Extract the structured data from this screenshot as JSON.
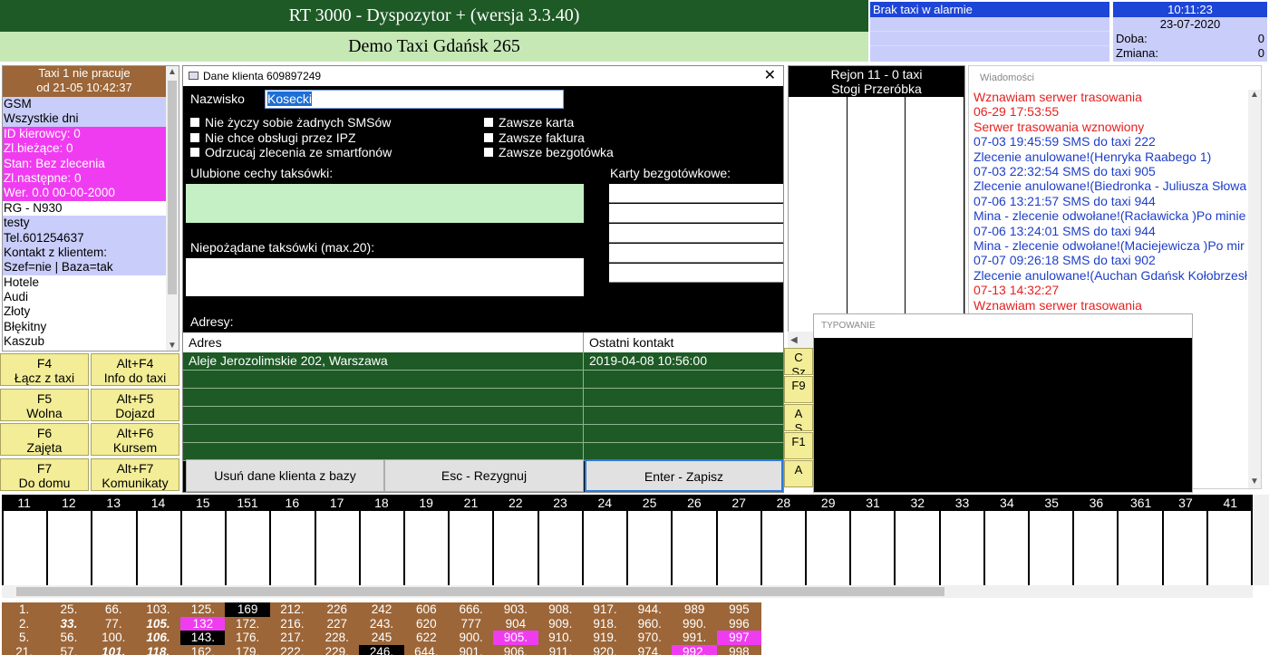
{
  "header": {
    "app_title": "RT 3000 - Dyspozytor + (wersja 3.3.40)",
    "company": "Demo Taxi Gdańsk 265"
  },
  "alarm": {
    "title": "Brak taxi w alarmie"
  },
  "clock": {
    "time": "10:11:23",
    "date": "23-07-2020",
    "doba_label": "Doba:",
    "doba_value": "0",
    "zmiana_label": "Zmiana:",
    "zmiana_value": "0"
  },
  "taxi_panel": {
    "header_line1": "Taxi 1 nie pracuje",
    "header_line2": "od 21-05  10:42:37",
    "lines": [
      {
        "text": "GSM",
        "style": "lav"
      },
      {
        "text": "Wszystkie dni",
        "style": "lav"
      },
      {
        "text": "ID kierowcy: 0",
        "style": "pink"
      },
      {
        "text": "Zl.bieżące: 0",
        "style": "pink"
      },
      {
        "text": "Stan: Bez zlecenia",
        "style": "pink"
      },
      {
        "text": "Zl.następne: 0",
        "style": "pink"
      },
      {
        "text": "Wer. 0.0 00-00-2000",
        "style": "pink"
      },
      {
        "text": "RG - N930",
        "style": "wht"
      },
      {
        "text": "testy",
        "style": "lav"
      },
      {
        "text": "Tel.601254637",
        "style": "lav"
      },
      {
        "text": "Kontakt z klientem:",
        "style": "lav"
      },
      {
        "text": "Szef=nie | Baza=tak",
        "style": "lav"
      },
      {
        "text": "Hotele",
        "style": "wht"
      },
      {
        "text": "Audi",
        "style": "wht"
      },
      {
        "text": "Złoty",
        "style": "wht"
      },
      {
        "text": "Błękitny",
        "style": "wht"
      },
      {
        "text": "Kaszub",
        "style": "wht"
      }
    ]
  },
  "fkeys": [
    {
      "key": "F4",
      "label": "Łącz z taxi"
    },
    {
      "key": "Alt+F4",
      "label": "Info do taxi"
    },
    {
      "key": "F5",
      "label": "Wolna"
    },
    {
      "key": "Alt+F5",
      "label": "Dojazd"
    },
    {
      "key": "F6",
      "label": "Zajęta"
    },
    {
      "key": "Alt+F6",
      "label": "Kursem"
    },
    {
      "key": "F7",
      "label": "Do domu"
    },
    {
      "key": "Alt+F7",
      "label": "Komunikaty"
    }
  ],
  "dialog": {
    "title": "Dane klienta 609897249",
    "close": "✕",
    "name_label": "Nazwisko",
    "name_value": "Kosecki",
    "checkboxes_left": [
      "Nie życzy sobie żadnych SMSów",
      "Nie chce obsługi przez IPZ",
      "Odrzucaj zlecenia ze smartfonów"
    ],
    "checkboxes_right": [
      "Zawsze karta",
      "Zawsze faktura",
      "Zawsze bezgotówka"
    ],
    "fav_label": "Ulubione cechy taksówki:",
    "cards_label": "Karty bezgotówkowe:",
    "unwanted_label": "Niepożądane taksówki (max.20):",
    "addresses_label": "Adresy:",
    "col_address": "Adres",
    "col_last_contact": "Ostatni kontakt",
    "addresses": [
      {
        "address": "Aleje Jerozolimskie 202, Warszawa",
        "last": "2019-04-08 10:56:00"
      },
      {
        "address": "",
        "last": ""
      },
      {
        "address": "",
        "last": ""
      },
      {
        "address": "",
        "last": ""
      },
      {
        "address": "",
        "last": ""
      },
      {
        "address": "",
        "last": ""
      }
    ],
    "btn_delete": "Usuń dane klienta z bazy",
    "btn_cancel": "Esc - Rezygnuj",
    "btn_save": "Enter - Zapisz"
  },
  "region": {
    "line1": "Rejon 11 - 0 taxi",
    "line2": "Stogi Przeróbka"
  },
  "messages": {
    "title": "Wiadomości",
    "items": [
      {
        "text": "Wznawiam serwer trasowania",
        "color": "red"
      },
      {
        "text": "06-29 17:53:55",
        "color": "red"
      },
      {
        "text": "Serwer trasowania wznowiony",
        "color": "red"
      },
      {
        "text": "07-03 19:45:59 SMS do taxi 222",
        "color": "blue"
      },
      {
        "text": "Zlecenie anulowane!(Henryka Raabego 1)",
        "color": "blue"
      },
      {
        "text": "07-03 22:32:54 SMS do taxi 905",
        "color": "blue"
      },
      {
        "text": "Zlecenie anulowane!(Biedronka - Juliusza Słowa",
        "color": "blue"
      },
      {
        "text": "07-06 13:21:57 SMS do taxi 944",
        "color": "blue"
      },
      {
        "text": "Mina - zlecenie odwołane!(Racławicka )Po minie",
        "color": "blue"
      },
      {
        "text": "07-06 13:24:01 SMS do taxi 944",
        "color": "blue"
      },
      {
        "text": "Mina - zlecenie odwołane!(Maciejewicza )Po mir",
        "color": "blue"
      },
      {
        "text": "07-07 09:26:18 SMS do taxi 902",
        "color": "blue"
      },
      {
        "text": "Zlecenie anulowane!(Auchan Gdańsk Kołobrzesł",
        "color": "blue"
      },
      {
        "text": "07-13 14:32:27",
        "color": "red"
      },
      {
        "text": "Wznawiam serwer trasowania",
        "color": "red"
      }
    ]
  },
  "typowanie": {
    "title": "TYPOWANIE"
  },
  "right_fkeys": [
    {
      "label": "C\nSz"
    },
    {
      "label": "F9"
    },
    {
      "label": "A\nS"
    },
    {
      "label": "F1"
    },
    {
      "label": "A"
    }
  ],
  "region_strip": [
    "11",
    "12",
    "13",
    "14",
    "15",
    "151",
    "16",
    "17",
    "18",
    "19",
    "21",
    "22",
    "23",
    "24",
    "25",
    "26",
    "27",
    "28",
    "29",
    "31",
    "32",
    "33",
    "34",
    "35",
    "36",
    "361",
    "37",
    "41"
  ],
  "bottom_rows": [
    [
      {
        "t": "1."
      },
      {
        "t": "25."
      },
      {
        "t": "66."
      },
      {
        "t": "103."
      },
      {
        "t": "125."
      },
      {
        "t": "169",
        "s": "bk"
      },
      {
        "t": "212."
      },
      {
        "t": "226"
      },
      {
        "t": "242"
      },
      {
        "t": "606"
      },
      {
        "t": "666."
      },
      {
        "t": "903."
      },
      {
        "t": "908."
      },
      {
        "t": "917."
      },
      {
        "t": "944."
      },
      {
        "t": "989"
      },
      {
        "t": "995"
      }
    ],
    [
      {
        "t": "2."
      },
      {
        "t": "33.",
        "s": "bb"
      },
      {
        "t": "77."
      },
      {
        "t": "105.",
        "s": "bb"
      },
      {
        "t": "132",
        "s": "bp"
      },
      {
        "t": "172."
      },
      {
        "t": "216."
      },
      {
        "t": "227"
      },
      {
        "t": "243."
      },
      {
        "t": "620"
      },
      {
        "t": "777"
      },
      {
        "t": "904"
      },
      {
        "t": "909."
      },
      {
        "t": "918."
      },
      {
        "t": "960."
      },
      {
        "t": "990."
      },
      {
        "t": "996"
      }
    ],
    [
      {
        "t": "5."
      },
      {
        "t": "56."
      },
      {
        "t": "100."
      },
      {
        "t": "106.",
        "s": "bb"
      },
      {
        "t": "143.",
        "s": "bk"
      },
      {
        "t": "176."
      },
      {
        "t": "217."
      },
      {
        "t": "228."
      },
      {
        "t": "245"
      },
      {
        "t": "622"
      },
      {
        "t": "900."
      },
      {
        "t": "905.",
        "s": "bp"
      },
      {
        "t": "910."
      },
      {
        "t": "919."
      },
      {
        "t": "970."
      },
      {
        "t": "991."
      },
      {
        "t": "997",
        "s": "bp"
      }
    ],
    [
      {
        "t": "21."
      },
      {
        "t": "57."
      },
      {
        "t": "101.",
        "s": "bb"
      },
      {
        "t": "118.",
        "s": "bb"
      },
      {
        "t": "162."
      },
      {
        "t": "179."
      },
      {
        "t": "222."
      },
      {
        "t": "229."
      },
      {
        "t": "246.",
        "s": "bk"
      },
      {
        "t": "644."
      },
      {
        "t": "901."
      },
      {
        "t": "906."
      },
      {
        "t": "911."
      },
      {
        "t": "920."
      },
      {
        "t": "974."
      },
      {
        "t": "992.",
        "s": "bp"
      },
      {
        "t": "998"
      }
    ]
  ]
}
